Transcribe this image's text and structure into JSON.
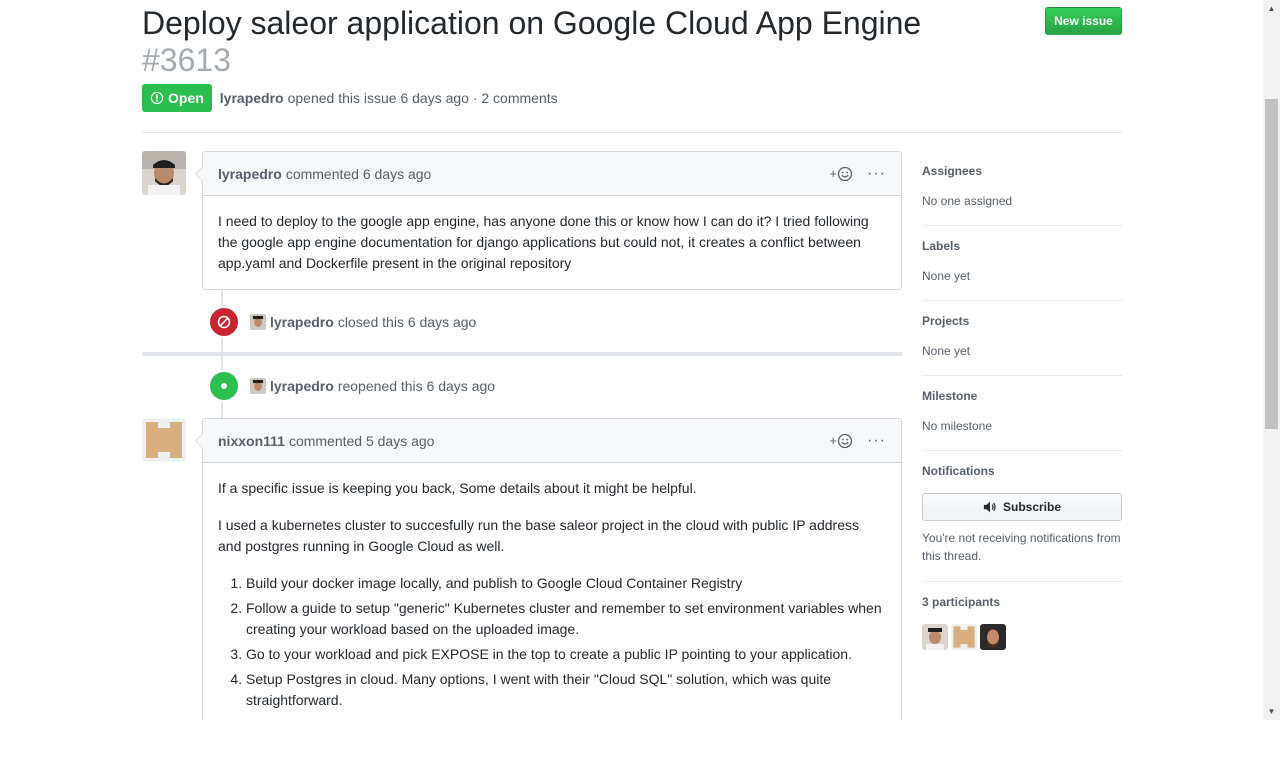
{
  "issue": {
    "title": "Deploy saleor application on Google Cloud App Engine",
    "number": "#3613",
    "state": "Open",
    "author": "lyrapedro",
    "meta": "opened this issue 6 days ago · 2 comments",
    "new_issue_label": "New issue"
  },
  "comments": [
    {
      "author": "lyrapedro",
      "action": "commented 6 days ago",
      "reaction_plus": "+",
      "more": "···",
      "body": [
        "I need to deploy to the google app engine, has anyone done this or know how I can do it? I tried following the google app engine documentation for django applications but could not, it creates a conflict between app.yaml and Dockerfile present in the original repository"
      ]
    },
    {
      "author": "nixxon111",
      "action": "commented 5 days ago",
      "reaction_plus": "+",
      "more": "···",
      "body": [
        "If a specific issue is keeping you back, Some details about it might be helpful.",
        "I used a kubernetes cluster to succesfully run the base saleor project in the cloud with public IP address and postgres running in Google Cloud as well."
      ],
      "list": [
        "Build your docker image locally, and publish to Google Cloud Container Registry",
        "Follow a guide to setup \"generic\" Kubernetes cluster and remember to set environment variables when creating your workload based on the uploaded image.",
        "Go to your workload and pick EXPOSE in the top to create a public IP pointing to your application.",
        "Setup Postgres in cloud. Many options, I went with their \"Cloud SQL\" solution, which was quite straightforward."
      ]
    }
  ],
  "events": [
    {
      "author": "lyrapedro",
      "action": "closed this 6 days ago",
      "type": "closed"
    },
    {
      "author": "lyrapedro",
      "action": "reopened this 6 days ago",
      "type": "reopened"
    }
  ],
  "sidebar": {
    "assignees": {
      "heading": "Assignees",
      "value": "No one assigned"
    },
    "labels": {
      "heading": "Labels",
      "value": "None yet"
    },
    "projects": {
      "heading": "Projects",
      "value": "None yet"
    },
    "milestone": {
      "heading": "Milestone",
      "value": "No milestone"
    },
    "notifications": {
      "heading": "Notifications",
      "button": "Subscribe",
      "reason": "You're not receiving notifications from this thread."
    },
    "participants": {
      "heading": "3 participants"
    }
  },
  "colors": {
    "green": "#2cbe4e",
    "red": "#cb2431",
    "muted": "#586069"
  }
}
